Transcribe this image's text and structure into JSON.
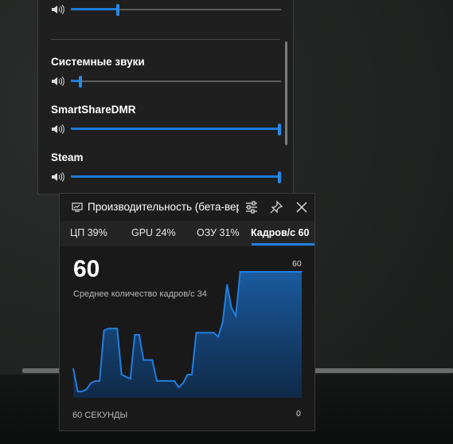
{
  "audio_panel": {
    "sources": [
      {
        "label": "",
        "volume": 0.22
      },
      {
        "label": "Системные звуки",
        "volume": 0.04
      },
      {
        "label": "SmartShareDMR",
        "volume": 1.0
      },
      {
        "label": "Steam",
        "volume": 1.0
      }
    ]
  },
  "perf_widget": {
    "title": "Производительность (бета-версия)",
    "tabs": [
      {
        "label": "ЦП  39%"
      },
      {
        "label": "GPU  24%"
      },
      {
        "label": "ОЗУ  31%"
      },
      {
        "label": "Кадров/с  60"
      }
    ],
    "current_value": "60",
    "average_label": "Среднее количество кадров/с  34",
    "max_label": "60",
    "min_label": "0",
    "duration_label": "60 СЕКУНДЫ",
    "accent_color": "#1f7fe0"
  },
  "chart_data": {
    "type": "area",
    "title": "",
    "xlabel": "60 СЕКУНДЫ",
    "ylabel": "",
    "ylim": [
      0,
      60
    ],
    "series": [
      {
        "values": [
          14,
          3,
          3,
          4,
          7,
          8,
          8,
          32,
          33,
          33,
          33,
          11,
          10,
          9,
          30,
          30,
          18,
          18,
          18,
          8,
          8,
          8,
          8,
          8,
          5,
          7,
          11,
          11,
          31,
          31,
          31,
          31,
          31,
          29,
          36,
          54,
          43,
          39,
          60,
          60,
          60,
          60,
          60,
          60,
          60,
          60,
          60,
          60,
          60,
          60,
          60,
          60,
          60
        ]
      }
    ]
  }
}
